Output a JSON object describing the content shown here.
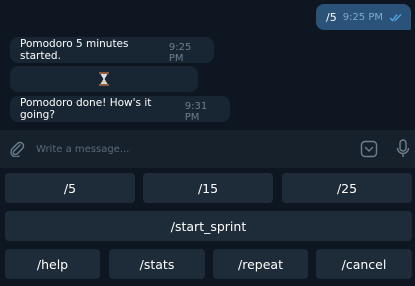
{
  "messages": {
    "outgoing": {
      "text": "/5",
      "time": "9:25 PM"
    },
    "incoming": [
      {
        "text": "Pomodoro 5 minutes started.",
        "time": "9:25 PM"
      },
      {
        "emoji": "hourglass"
      },
      {
        "text": "Pomodoro done! How's it going?",
        "time": "9:31 PM"
      }
    ]
  },
  "composer": {
    "placeholder": "Write a message..."
  },
  "keyboard": {
    "row1": [
      "/5",
      "/15",
      "/25"
    ],
    "row2": [
      "/start_sprint"
    ],
    "row3": [
      "/help",
      "/stats",
      "/repeat",
      "/cancel"
    ]
  },
  "colors": {
    "background": "#0e1621",
    "outgoing_bubble": "#2b5278",
    "incoming_bubble": "#182533",
    "keyboard_button": "#1e2c3a",
    "read_check": "#4fa3e0"
  },
  "icons": [
    "attach-icon",
    "emoji-icon",
    "microphone-icon",
    "double-check-icon",
    "hourglass-icon"
  ]
}
